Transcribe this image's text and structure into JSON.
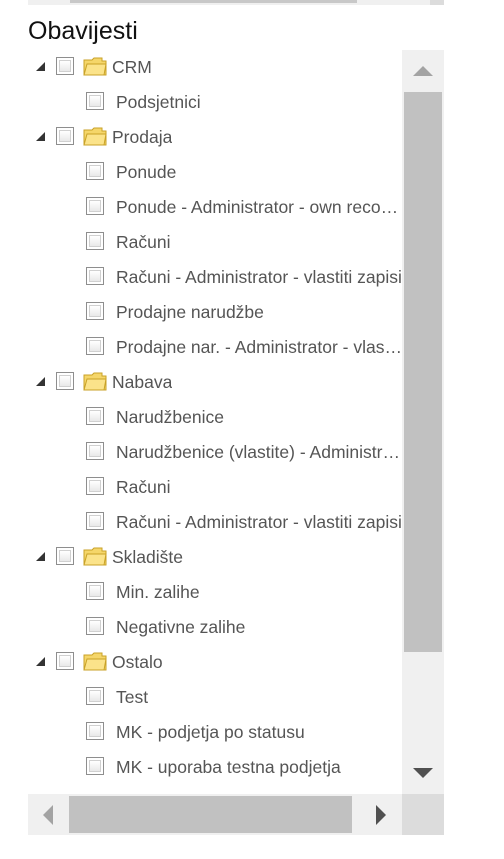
{
  "section": {
    "title": "Obavijesti"
  },
  "tree": {
    "groups": [
      {
        "label": "CRM",
        "items": [
          "Podsjetnici"
        ]
      },
      {
        "label": "Prodaja",
        "items": [
          "Ponude",
          "Ponude - Administrator - own records",
          "Računi",
          "Računi - Administrator - vlastiti zapisi",
          "Prodajne narudžbe",
          "Prodajne nar. - Administrator - vlastiti zapisi"
        ]
      },
      {
        "label": "Nabava",
        "items": [
          "Narudžbenice",
          "Narudžbenice (vlastite) - Administrator",
          "Računi",
          "Računi - Administrator - vlastiti zapisi"
        ]
      },
      {
        "label": "Skladište",
        "items": [
          "Min. zalihe",
          "Negativne zalihe"
        ]
      },
      {
        "label": "Ostalo",
        "items": [
          "Test",
          "MK - podjetja po statusu",
          "MK - uporaba testna podjetja"
        ]
      }
    ]
  },
  "icons": {
    "expand": "triangle-expanded-icon",
    "checkbox": "checkbox-icon",
    "folder": "folder-icon",
    "scroll_up": "arrow-up-icon",
    "scroll_down": "arrow-down-icon",
    "scroll_left": "arrow-left-icon",
    "scroll_right": "arrow-right-icon"
  },
  "colors": {
    "text": "#555555",
    "title": "#111111",
    "folder_fill": "#f5d66a",
    "folder_stroke": "#c9a227",
    "scroll_track": "#f0f0f0",
    "scroll_thumb": "#c1c1c1"
  }
}
